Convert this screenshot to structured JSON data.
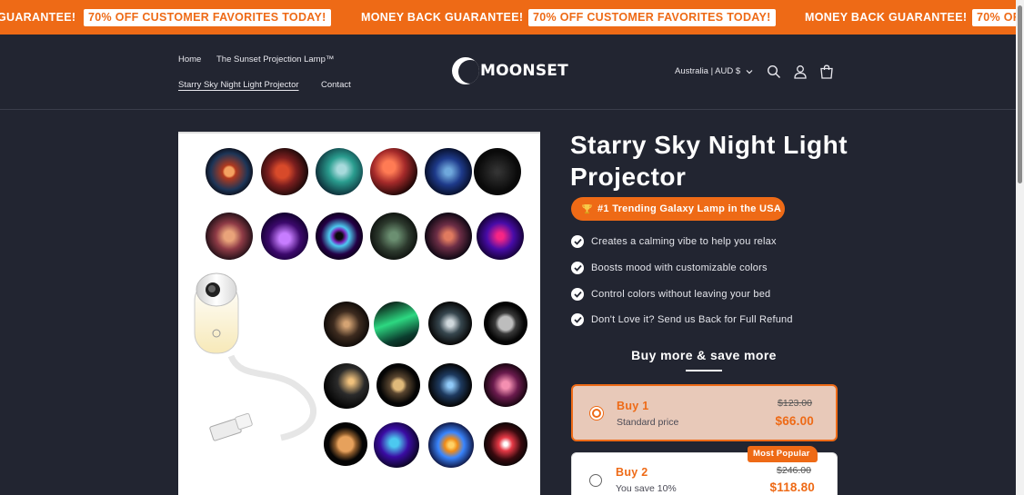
{
  "announcement": {
    "items": [
      {
        "text": "MONEY BACK GUARANTEE!",
        "style": "plain"
      },
      {
        "text": "70% OFF CUSTOMER FAVORITES TODAY!",
        "style": "pill"
      }
    ],
    "visible": [
      "GUARANTEE!",
      "70% OFF CUSTOMER FAVORITES TODAY!",
      "MONEY BACK GUARANTEE!",
      "70% OFF CUSTOMER FAVORITES TODAY!",
      "MONEY BACK GUARANTEE!",
      "70% OF"
    ]
  },
  "header": {
    "nav": [
      {
        "label": "Home"
      },
      {
        "label": "The Sunset Projection Lamp™"
      },
      {
        "label": "Starry Sky Night Light Projector",
        "active": true
      },
      {
        "label": "Contact"
      }
    ],
    "logo_text": "MOONSET",
    "locale": "Australia | AUD $",
    "icons": [
      "search-icon",
      "account-icon",
      "cart-icon"
    ]
  },
  "product": {
    "title": "Starry Sky Night Light Projector",
    "trending_badge": "#1 Trending Galaxy Lamp in the USA",
    "trending_icon": "trophy-icon",
    "bullets": [
      "Creates a calming vibe to help you relax",
      "Boosts mood with customizable colors",
      "Control colors without leaving your bed",
      "Don't Love it? Send us Back for Full Refund"
    ],
    "bundle_heading": "Buy more & save more",
    "options": [
      {
        "name": "Buy 1",
        "sub": "Standard price",
        "compare_price": "$123.00",
        "price": "$66.00",
        "selected": true
      },
      {
        "name": "Buy 2",
        "sub": "You save 10%",
        "compare_price": "$246.00",
        "price": "$118.80",
        "selected": false,
        "badge": "Most Popular"
      }
    ]
  },
  "colors": {
    "accent": "#ee6a16",
    "background": "#222531",
    "selected_option_bg": "#e8c9b9"
  }
}
